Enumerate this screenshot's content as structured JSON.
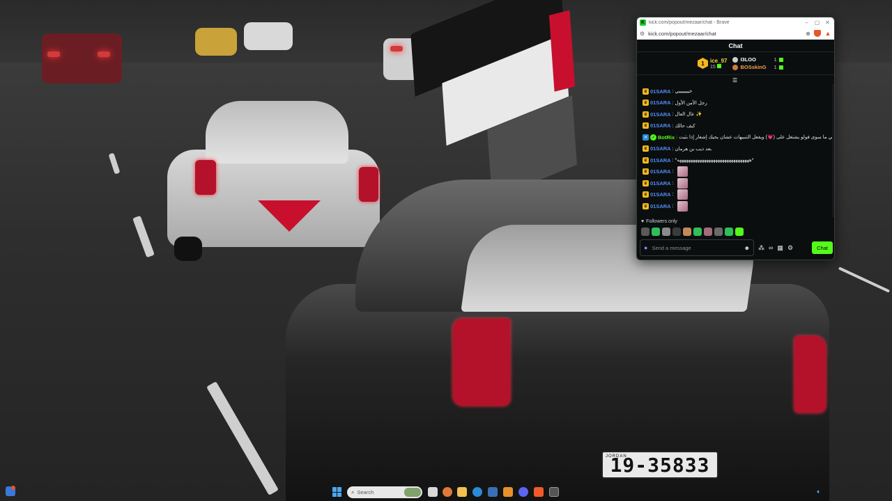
{
  "wallpaper": {
    "plate_text": "19-35833",
    "plate_small": "JORDAN"
  },
  "window": {
    "title": "kick.com/popout/mezaar/chat - Brave",
    "url": "kick.com/popout/mezaar/chat",
    "controls": {
      "minimize": "–",
      "maximize": "▢",
      "close": "✕"
    }
  },
  "chat": {
    "header": "Chat",
    "leaderboard": {
      "first": {
        "rank": "1",
        "name": "ice_97",
        "count": "15"
      },
      "others": [
        {
          "name": "I3LOO",
          "count": "1"
        },
        {
          "name": "BOSskinG",
          "count": "1"
        }
      ]
    },
    "messages": [
      {
        "user": "01SARA",
        "text": ": خيييييييي"
      },
      {
        "user": "01SARA",
        "text": ": رجل الأمن الأول"
      },
      {
        "user": "01SARA",
        "text": ": عال العال ✨"
      },
      {
        "user": "01SARA",
        "text": ": كيف حالك"
      },
      {
        "user": "BotRix",
        "text": ": إلي ما سوى فولو يشتغل على (💗) ويفعل التنبيهات عشان يجيك إشعار إذا بثيت",
        "bot": true
      },
      {
        "user": "01SARA",
        "text": ": بعد ذيب بن هرمان"
      },
      {
        "user": "01SARA",
        "text": ": *ههههههههههههههههههههههههههههههههه*"
      },
      {
        "user": "01SARA",
        "text": ":",
        "emote": true
      },
      {
        "user": "01SARA",
        "text": ":",
        "emote": true
      },
      {
        "user": "01SARA",
        "text": ":",
        "emote": true
      },
      {
        "user": "01SARA",
        "text": ":",
        "emote": true
      }
    ],
    "followers_only": "Followers only",
    "input_placeholder": "Send a message",
    "send_label": "Chat"
  },
  "taskbar": {
    "search_placeholder": "Search"
  },
  "colors": {
    "kick_green": "#53fc18",
    "username_blue": "#4f8ef7",
    "badge_gold": "#f3b91d"
  }
}
